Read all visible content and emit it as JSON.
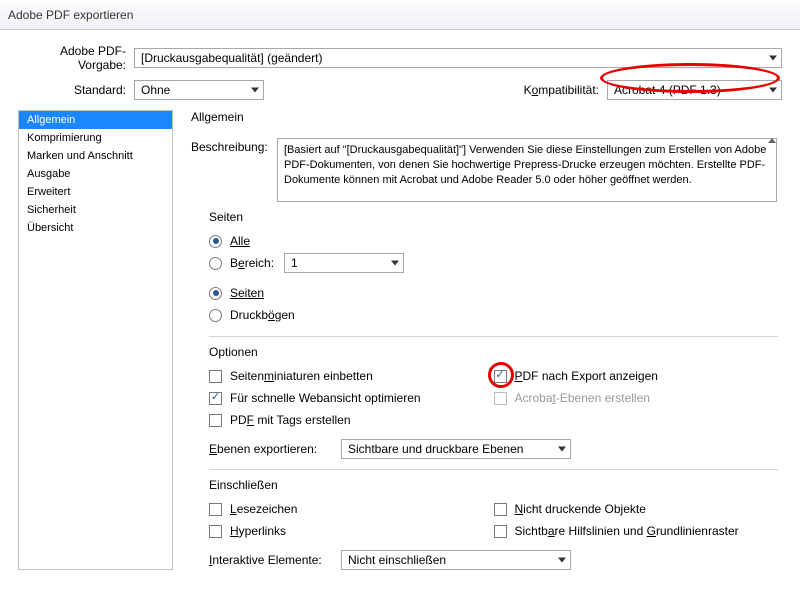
{
  "window_title": "Adobe PDF exportieren",
  "preset_label": "Adobe PDF-Vorgabe:",
  "preset_value": "[Druckausgabequalität] (geändert)",
  "standard_label": "Standard:",
  "standard_value": "Ohne",
  "compat_label_pre": "K",
  "compat_label_mid": "o",
  "compat_label_post": "mpatibilität:",
  "compat_value": "Acrobat 4 (PDF 1.3)",
  "sidebar": {
    "items": [
      {
        "label": "Allgemein",
        "selected": true
      },
      {
        "label": "Komprimierung",
        "selected": false
      },
      {
        "label": "Marken und Anschnitt",
        "selected": false
      },
      {
        "label": "Ausgabe",
        "selected": false
      },
      {
        "label": "Erweitert",
        "selected": false
      },
      {
        "label": "Sicherheit",
        "selected": false
      },
      {
        "label": "Übersicht",
        "selected": false
      }
    ]
  },
  "panel": {
    "heading": "Allgemein",
    "description_label": "Beschreibung:",
    "description_text": "[Basiert auf \"[Druckausgabequalität]\"] Verwenden Sie diese Einstellungen zum Erstellen von Adobe PDF-Dokumenten, von denen Sie hochwertige Prepress-Drucke erzeugen möchten. Erstellte PDF-Dokumente können mit Acrobat und Adobe Reader 5.0 oder höher geöffnet werden.",
    "pages_title": "Seiten",
    "radio_all": "Alle",
    "radio_range_pre": "B",
    "radio_range_under": "e",
    "radio_range_post": "reich:",
    "range_value": "1",
    "radio_pages": "Seiten",
    "radio_spreads_pre": "Druckb",
    "radio_spreads_under": "ö",
    "radio_spreads_post": "gen",
    "options_title": "Optionen",
    "opt_thumbs_pre": "Seiten",
    "opt_thumbs_under": "m",
    "opt_thumbs_post": "iniaturen einbetten",
    "opt_view_pre": "",
    "opt_view_under": "P",
    "opt_view_post": "DF nach Export anzeigen",
    "opt_web": "Für schnelle Webansicht optimieren",
    "opt_layers_pre": "Acroba",
    "opt_layers_under": "t",
    "opt_layers_post": "-Ebenen erstellen",
    "opt_tags_pre": "PD",
    "opt_tags_under": "F",
    "opt_tags_post": " mit Tags erstellen",
    "ebenen_label_pre": "",
    "ebenen_label_under": "E",
    "ebenen_label_post": "benen exportieren:",
    "ebenen_value": "Sichtbare und druckbare Ebenen",
    "include_title": "Einschließen",
    "inc_bookmarks_pre": "",
    "inc_bookmarks_under": "L",
    "inc_bookmarks_post": "esezeichen",
    "inc_nonprint_pre": "",
    "inc_nonprint_under": "N",
    "inc_nonprint_post": "icht druckende Objekte",
    "inc_hyper_pre": "",
    "inc_hyper_under": "H",
    "inc_hyper_post": "yperlinks",
    "inc_guides_pre": "Sichtb",
    "inc_guides_under": "a",
    "inc_guides_post": "re Hilfslinien und ",
    "inc_guides_under2": "G",
    "inc_guides_post2": "rundlinienraster",
    "inter_label_pre": "",
    "inter_label_under": "I",
    "inter_label_post": "nteraktive Elemente:",
    "inter_value": "Nicht einschließen"
  }
}
